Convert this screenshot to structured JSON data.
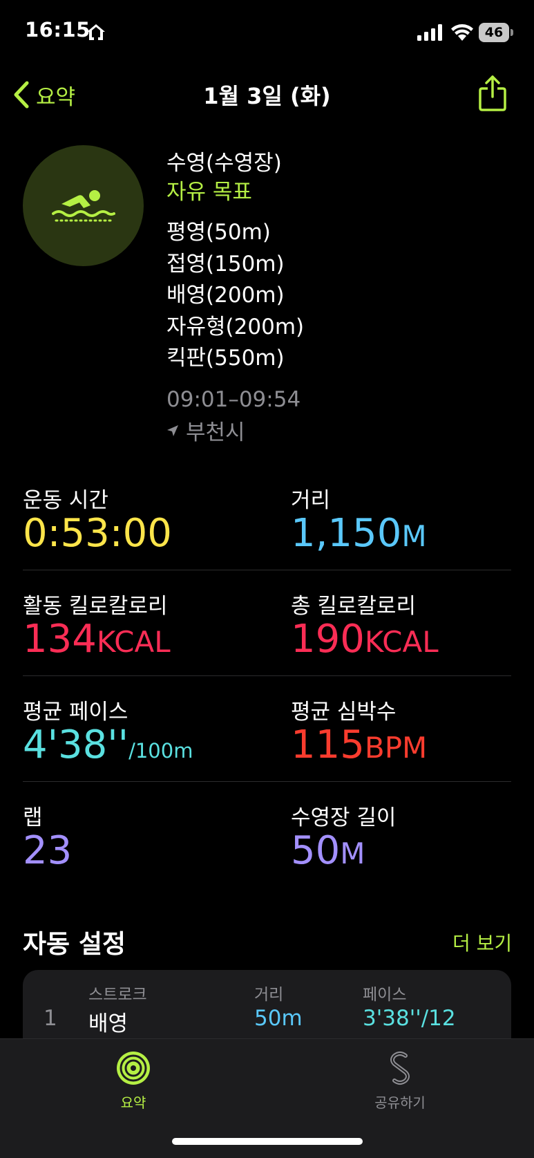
{
  "status_bar": {
    "time": "16:15",
    "battery": "46"
  },
  "nav": {
    "back_label": "요약",
    "title": "1월 3일 (화)"
  },
  "workout": {
    "type": "수영(수영장)",
    "goal": "자유 목표",
    "strokes": [
      "평영(50m)",
      "접영(150m)",
      "배영(200m)",
      "자유형(200m)",
      "킥판(550m)"
    ],
    "time_range": "09:01–09:54",
    "location": "부천시"
  },
  "metrics": [
    {
      "label": "운동 시간",
      "value": "0:53:00",
      "unit": "",
      "color": "#fde54a"
    },
    {
      "label": "거리",
      "value": "1,150",
      "unit": "M",
      "color": "#5ac8fa"
    },
    {
      "label": "활동 킬로칼로리",
      "value": "134",
      "unit": "KCAL",
      "color": "#fa2d55"
    },
    {
      "label": "총 킬로칼로리",
      "value": "190",
      "unit": "KCAL",
      "color": "#fa2d55"
    },
    {
      "label": "평균 페이스",
      "value": "4'38''",
      "unit": "/100m",
      "color": "#5ae0e0"
    },
    {
      "label": "평균 심박수",
      "value": "115",
      "unit": "BPM",
      "color": "#fa3c2e"
    },
    {
      "label": "랩",
      "value": "23",
      "unit": "",
      "color": "#a390ff"
    },
    {
      "label": "수영장 길이",
      "value": "50",
      "unit": "M",
      "color": "#a390ff"
    }
  ],
  "auto_sets": {
    "title": "자동 설정",
    "more_label": "더 보기",
    "columns": [
      "스트로크",
      "거리",
      "페이스"
    ],
    "rows": [
      {
        "index": "1",
        "stroke": "배영",
        "distance": "50m",
        "pace": "3'38''/12"
      }
    ]
  },
  "tabs": [
    {
      "label": "요약",
      "active": true
    },
    {
      "label": "공유하기",
      "active": false
    }
  ]
}
